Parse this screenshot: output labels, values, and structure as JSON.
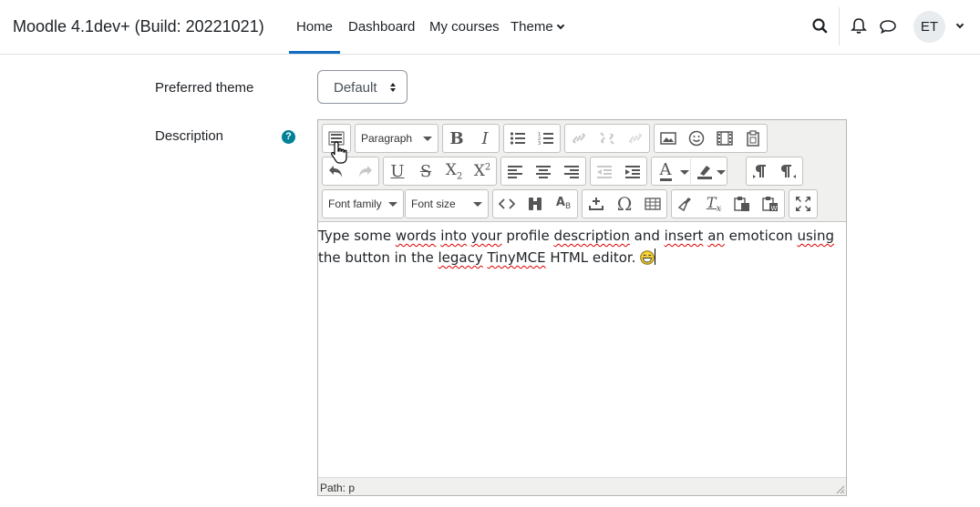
{
  "navbar": {
    "brand": "Moodle 4.1dev+ (Build: 20221021)",
    "links": [
      "Home",
      "Dashboard",
      "My courses",
      "Theme"
    ],
    "active_link": "Home",
    "avatar_initials": "ET",
    "icons": [
      "search-icon",
      "bell-icon",
      "chat-icon",
      "chevron-down-icon"
    ]
  },
  "form": {
    "preferred_theme_label": "Preferred theme",
    "preferred_theme_value": "Default",
    "description_label": "Description",
    "help_icon_glyph": "?"
  },
  "editor": {
    "toolbar": {
      "paragraph_select": "Paragraph",
      "font_family_select": "Font family",
      "font_size_select": "Font size"
    },
    "content_words": {
      "w1": "Type some ",
      "w2": "words",
      "w3": " ",
      "w4": "into",
      "w5": " ",
      "w6": "your",
      "w7": " profile ",
      "w8": "description",
      "w9": " and ",
      "w10": "insert",
      "w11": " ",
      "w12": "an",
      "w13": " emoticon ",
      "w14": "using",
      "w15": " the button in the ",
      "w16": "legacy",
      "w17": " ",
      "w18": "TinyMCE",
      "w19": " HTML editor. "
    },
    "status_path": "Path: p"
  },
  "colors": {
    "accent": "#0f6cbf",
    "help": "#008196",
    "toolbar_bg": "#f0f0ee"
  }
}
